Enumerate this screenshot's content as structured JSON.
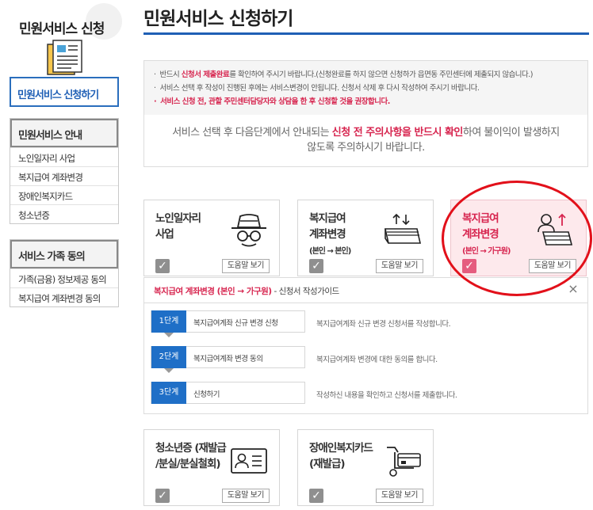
{
  "sidebar": {
    "title": "민원서비스 신청",
    "active_item": "민원서비스 신청하기",
    "groups": [
      {
        "head": "민원서비스 안내",
        "items": [
          "노인일자리 사업",
          "복지급여 계좌변경",
          "장애인복지카드",
          "청소년증"
        ]
      },
      {
        "head": "서비스 가족 동의",
        "items": [
          "가족(금융) 정보제공 동의",
          "복지급여 계좌변경 동의"
        ]
      }
    ]
  },
  "header": {
    "title": "민원서비스 신청하기"
  },
  "notice": {
    "lines": [
      {
        "pre": "반드시 ",
        "red": "신청서 제출완료",
        "post": "를 확인하여 주시기 바랍니다.(신청완료를 하지 않으면 신청하가 읍면동 주민센터에 제출되지 않습니다.)"
      },
      {
        "pre": "서비스 선택 후 작성이 진행된 후에는 서비스변경이 안됩니다. 신청서 삭제 후 다시 작성하여 주시기 바랍니다.",
        "red": "",
        "post": ""
      },
      {
        "pre": "",
        "red": "서비스 신청 전, 관할 주민센터담당자와 상담을 한 후 신청할 것을 권장합니다.",
        "post": ""
      }
    ],
    "message": {
      "pre": "서비스 선택 후 다음단계에서 안내되는 ",
      "red": "신청 전 주의사항을 반드시 확인",
      "post": "하여 불이익이 발생하지",
      "line2": "않도록 주의하시기 바랍니다."
    }
  },
  "cards": {
    "help_label": "도움말 보기",
    "check_mark": "✓",
    "row1": [
      {
        "line1": "노인일자리",
        "line2": "사업",
        "sub": "",
        "icon": "hat-glasses-icon"
      },
      {
        "line1": "복지급여",
        "line2": "계좌변경",
        "sub": "(본인 → 본인)",
        "icon": "account-transfer-icon"
      },
      {
        "line1": "복지급여",
        "line2": "계좌변경",
        "sub": "(본인 → 가구원)",
        "icon": "family-transfer-icon"
      }
    ],
    "row2": [
      {
        "line1": "청소년증 (재발급",
        "line2": "/분실/분실철회)",
        "sub": "",
        "icon": "id-card-icon"
      },
      {
        "line1": "장애인복지카드",
        "line2": "(재발급)",
        "sub": "",
        "icon": "welfare-card-icon"
      }
    ]
  },
  "guide": {
    "head_red": "복지급여 계좌변경 (본인 → 가구원)",
    "head_rest": " - 신청서 작성가이드",
    "close": "×",
    "steps": [
      {
        "badge": "1단계",
        "label": "복지급여계좌 신규 변경 신청",
        "desc": "복지급여계좌 신규 변경 신청서를 작성합니다."
      },
      {
        "badge": "2단계",
        "label": "복지급여계좌 변경 동의",
        "desc": "복지급여계좌 변경에 대한 동의를 합니다."
      },
      {
        "badge": "3단계",
        "label": "신청하기",
        "desc": "작성하신 내용을 확인하고 신청서를 제출합니다."
      }
    ]
  },
  "colors": {
    "accent": "#1f6fc7",
    "highlight": "#d7254f",
    "annotation": "#e2101a"
  }
}
